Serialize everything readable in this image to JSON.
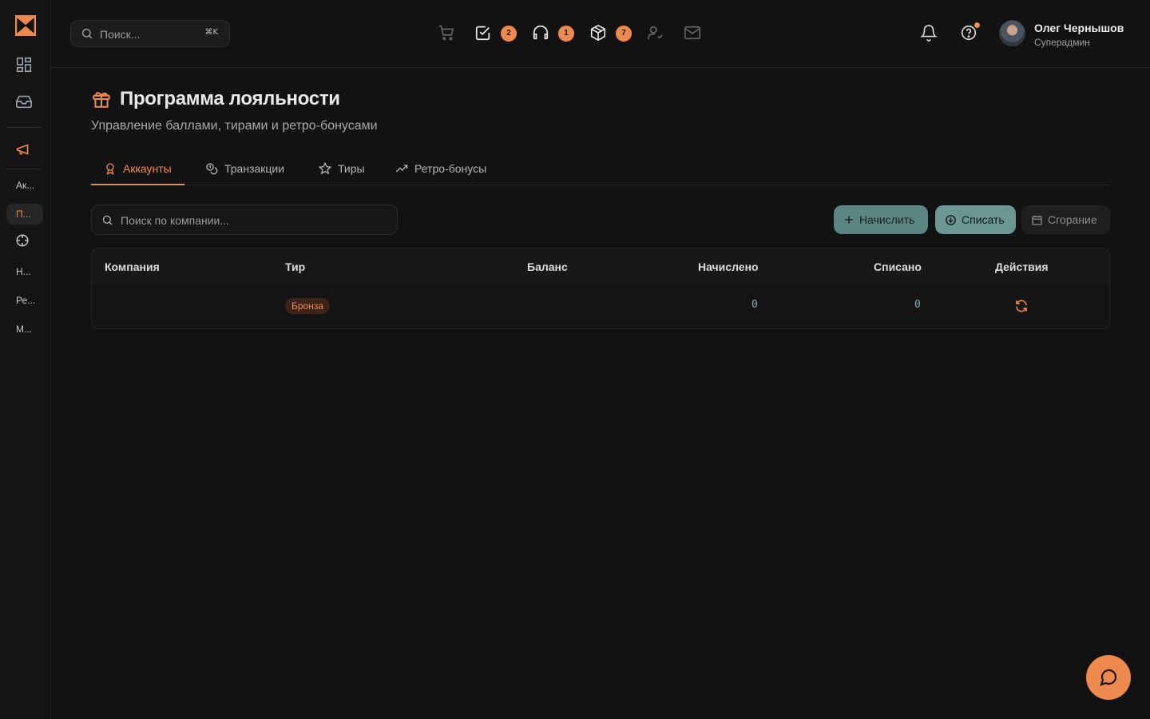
{
  "colors": {
    "accent": "#ef8a4f",
    "teal": "#6a9694",
    "background": "#121212"
  },
  "sidebar": {
    "items": [
      {
        "label": "Ак...",
        "active": false
      },
      {
        "label": "П...",
        "active": true
      },
      {
        "label": "Н...",
        "active": false
      },
      {
        "label": "Ре...",
        "active": false
      },
      {
        "label": "М...",
        "active": false
      }
    ]
  },
  "header": {
    "search_placeholder": "Поиск...",
    "search_shortcut": "⌘K",
    "badges": {
      "tasks": "2",
      "support": "1",
      "packages": "7"
    },
    "user_name": "Олег Чернышов",
    "user_role": "Суперадмин"
  },
  "page": {
    "title": "Программа лояльности",
    "subtitle": "Управление баллами, тирами и ретро-бонусами"
  },
  "tabs": [
    {
      "label": "Аккаунты",
      "icon": "award-icon"
    },
    {
      "label": "Транзакции",
      "icon": "coins-icon"
    },
    {
      "label": "Тиры",
      "icon": "star-icon"
    },
    {
      "label": "Ретро-бонусы",
      "icon": "trending-up-icon"
    }
  ],
  "toolbar": {
    "company_search_placeholder": "Поиск по компании...",
    "accrue_label": "Начислить",
    "write_off_label": "Списать",
    "burn_label": "Сгорание"
  },
  "table": {
    "columns": [
      "Компания",
      "Тир",
      "Баланс",
      "Начислено",
      "Списано",
      "Действия"
    ],
    "rows": [
      {
        "company": "",
        "tier": "Бронза",
        "balance": "",
        "accrued": "0",
        "written_off": "0"
      }
    ]
  }
}
